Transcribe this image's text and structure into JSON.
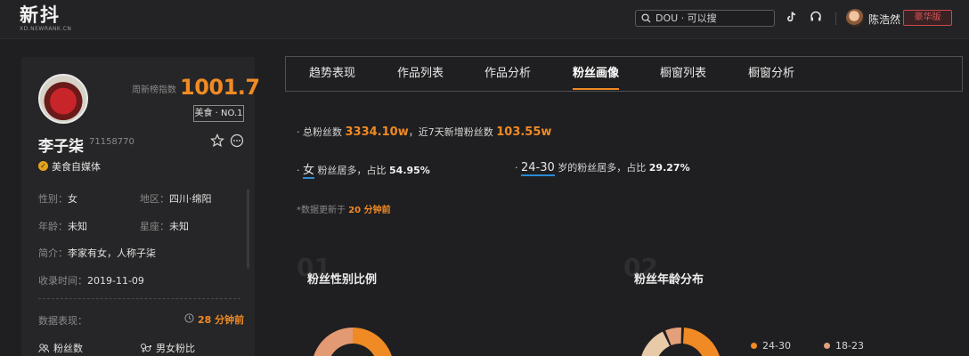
{
  "header": {
    "logo": "新抖",
    "logo_sub": "XD.NEWRANK.CN",
    "search_placeholder": "DOU · 可以搜",
    "user_name": "陈浩然",
    "vip_label": "豪华版"
  },
  "profile": {
    "index_label": "周新榜指数",
    "index_value": "1001.7",
    "rank_badge": "美食 · NO.1",
    "name": "李子柒",
    "uid": "71158770",
    "category": "美食自媒体",
    "gender_key": "性别：",
    "gender_val": "女",
    "region_key": "地区：",
    "region_val": "四川·绵阳",
    "age_key": "年龄：",
    "age_val": "未知",
    "zodiac_key": "星座：",
    "zodiac_val": "未知",
    "intro_key": "简介：",
    "intro_val": "李家有女，人称子柒",
    "date_key": "收录时间：",
    "date_val": "2019-11-09",
    "data_label": "数据表现：",
    "update_time": "28 分钟前",
    "stat_fans": "粉丝数",
    "stat_gender": "男女粉比"
  },
  "tabs": [
    "趋势表现",
    "作品列表",
    "作品分析",
    "粉丝画像",
    "橱窗列表",
    "橱窗分析"
  ],
  "active_tab": "粉丝画像",
  "summary": {
    "total_prefix": "· 总粉丝数 ",
    "total_value": "3334.10w",
    "new_prefix": "，近7天新增粉丝数 ",
    "new_value": "103.55w",
    "gender_dot": "· ",
    "gender_hl": "女",
    "gender_text": " 粉丝居多，占比 ",
    "gender_pct": "54.95%",
    "age_dot": "· ",
    "age_hl": "24-30",
    "age_text": " 岁的粉丝居多，占比 ",
    "age_pct": "29.27%",
    "note_prefix": "*数据更新于 ",
    "note_time": "20 分钟前"
  },
  "sections": {
    "s1_num": "01",
    "s1_title": "粉丝性别比例",
    "s2_num": "02",
    "s2_title": "粉丝年龄分布",
    "legend_1": "24-30",
    "legend_2": "18-23"
  },
  "colors": {
    "accent": "#f08a24",
    "female": "#f08a24",
    "male": "#e39a72",
    "age_1": "#f08a24",
    "age_2": "#e3a07a",
    "age_3": "#e8c9a8"
  }
}
